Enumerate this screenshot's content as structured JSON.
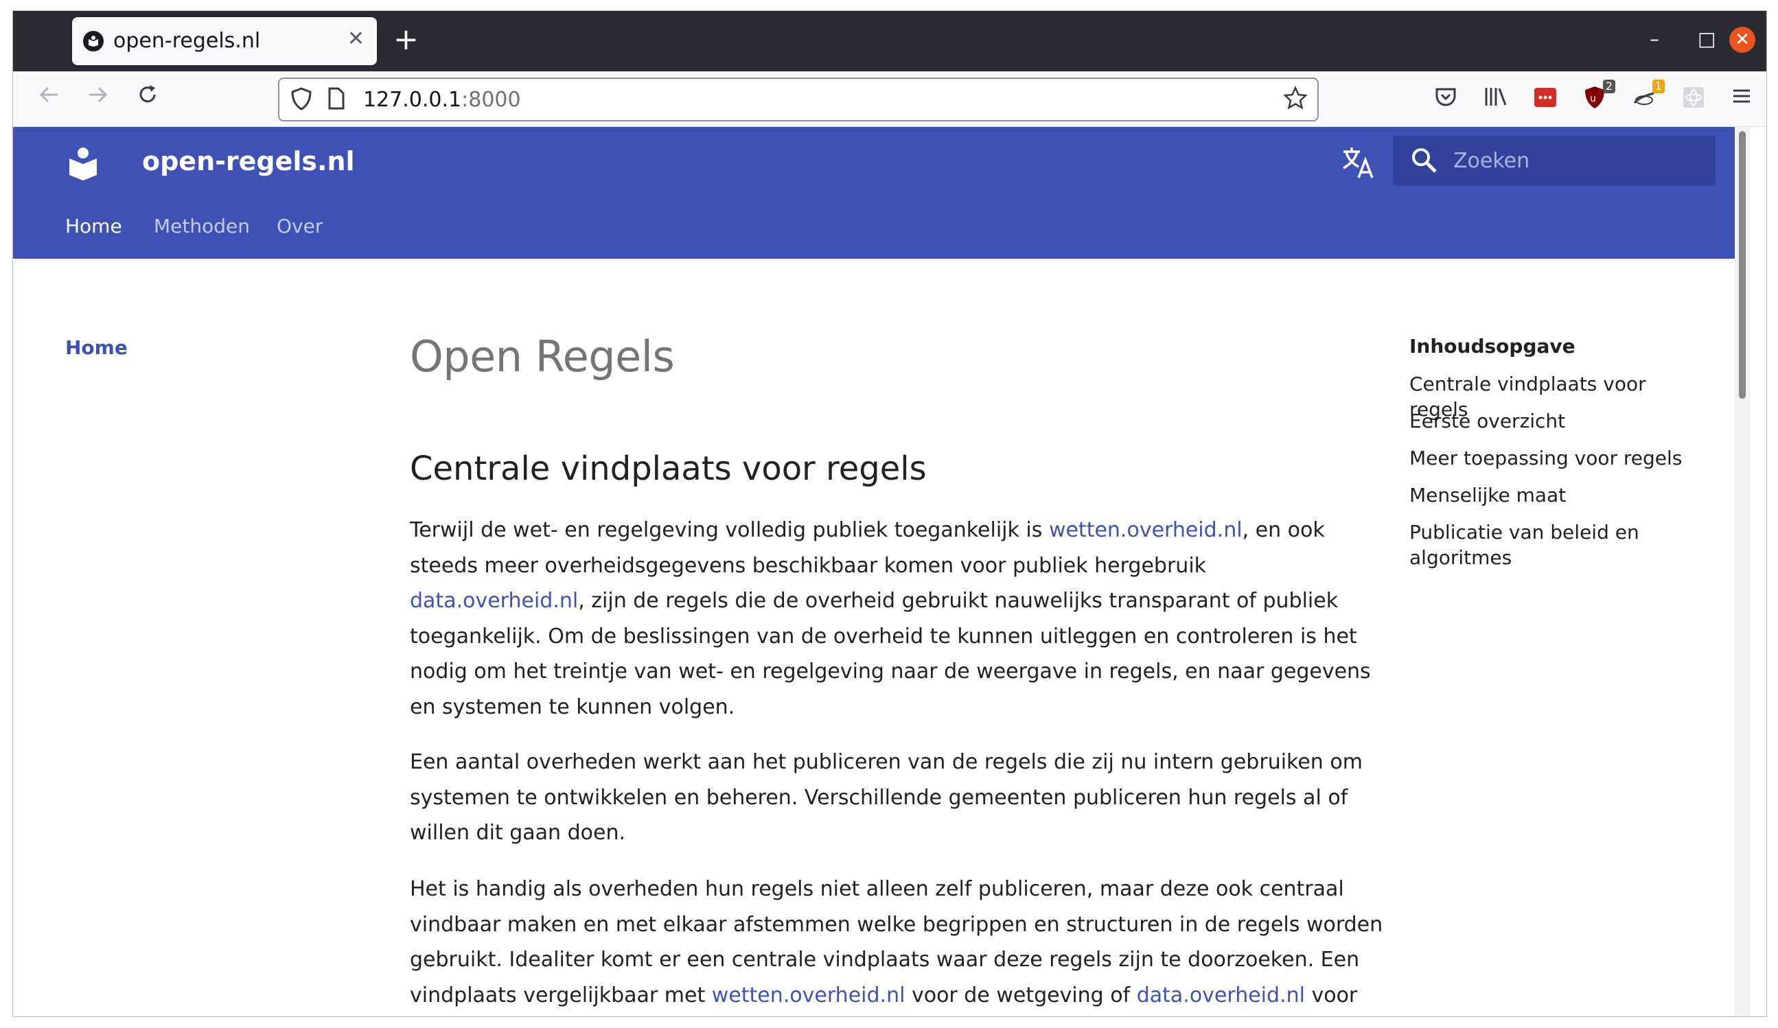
{
  "browser": {
    "tab_title": "open-regels.nl",
    "tab_close": "✕",
    "new_tab": "+",
    "url_host": "127.0.0.1",
    "url_port": ":8000",
    "minimize": "–",
    "maximize": "□",
    "close": "✕",
    "ext_badge_1": "2",
    "ext_badge_2": "1"
  },
  "header": {
    "site_title": "open-regels.nl",
    "search_placeholder": "Zoeken",
    "tabs": [
      {
        "label": "Home"
      },
      {
        "label": "Methoden"
      },
      {
        "label": "Over"
      }
    ]
  },
  "sidebar": {
    "home": "Home"
  },
  "content": {
    "title": "Open Regels",
    "section_title": "Centrale vindplaats voor regels",
    "p1": {
      "t1": "Terwijl de wet- en regelgeving volledig publiek toegankelijk is ",
      "link1": "wetten.overheid.nl",
      "t2": ", en ook steeds meer overheidsgegevens beschikbaar komen voor publiek hergebruik ",
      "link2": "data.overheid.nl",
      "t3": ", zijn de regels die de overheid gebruikt nauwelijks transparant of publiek toegankelijk. Om de beslissingen van de overheid te kunnen uitleggen en controleren is het nodig om het treintje van wet- en regelgeving naar de weergave in regels, en naar gegevens en systemen te kunnen volgen."
    },
    "p2": "Een aantal overheden werkt aan het publiceren van de regels die zij nu intern gebruiken om systemen te ontwikkelen en beheren. Verschillende gemeenten publiceren hun regels al of willen dit gaan doen.",
    "p3": {
      "t1": "Het is handig als overheden hun regels niet alleen zelf publiceren, maar deze ook centraal vindbaar maken en met elkaar afstemmen welke begrippen en structuren in de regels worden gebruikt. Idealiter komt er een centrale vindplaats waar deze regels zijn te doorzoeken. Een vindplaats vergelijkbaar met ",
      "link1": "wetten.overheid.nl",
      "t2": " voor de wetgeving of ",
      "link2": "data.overheid.nl",
      "t3": " voor gegevens-bronnen van de overheid."
    }
  },
  "toc": {
    "title": "Inhoudsopgave",
    "items": [
      "Centrale vindplaats voor regels",
      "Eerste overzicht",
      "Meer toepassing voor regels",
      "Menselijke maat",
      "Publicatie van beleid en algoritmes"
    ]
  },
  "colors": {
    "header": "#3f51b5",
    "link": "#3f51b5"
  }
}
